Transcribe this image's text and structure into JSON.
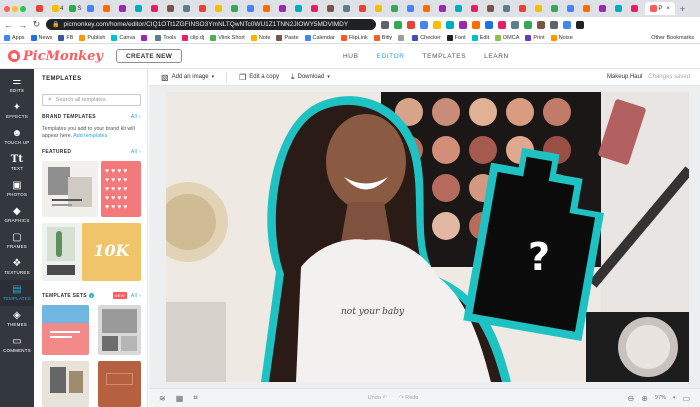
{
  "browser": {
    "tabs": [
      "",
      "4",
      "S",
      "",
      "",
      "",
      "",
      "",
      "",
      "",
      "",
      "",
      "",
      "",
      "",
      "",
      "",
      "",
      "",
      "",
      "",
      "",
      "",
      "",
      "",
      "",
      "",
      "",
      "",
      "",
      "",
      "",
      "",
      "",
      "",
      "",
      "",
      "",
      "P"
    ],
    "active_tab_label": "P",
    "new_tab": "+",
    "url": "picmonkey.com/home/editor/CIQ1OTt1ZGFINSO3YmNLTQwNTc0WU1Z1TNN2JIOWY5MDVIMDY",
    "bookmarks": [
      {
        "label": "Apps",
        "color": "#4285f4"
      },
      {
        "label": "News",
        "color": "#1a73e8"
      },
      {
        "label": "FB",
        "color": "#3b5998"
      },
      {
        "label": "Publish",
        "color": "#ff9800"
      },
      {
        "label": "Canva",
        "color": "#00c4cc"
      },
      {
        "label": "",
        "color": "#9c27b0"
      },
      {
        "label": "Tools",
        "color": "#607d8b"
      },
      {
        "label": "clip.dj",
        "color": "#e91e63"
      },
      {
        "label": "Vlink Short",
        "color": "#4caf50"
      },
      {
        "label": "Note",
        "color": "#f4b400"
      },
      {
        "label": "Paste",
        "color": "#795548"
      },
      {
        "label": "Calendar",
        "color": "#4285f4"
      },
      {
        "label": "FlipLink",
        "color": "#ff5722"
      },
      {
        "label": "Bitly",
        "color": "#ee6123"
      },
      {
        "label": "",
        "color": "#9e9e9e"
      },
      {
        "label": "Checker",
        "color": "#3f51b5"
      },
      {
        "label": "Font",
        "color": "#222222"
      },
      {
        "label": "Edit",
        "color": "#00bcd4"
      },
      {
        "label": "DMCA",
        "color": "#8bc34a"
      },
      {
        "label": "Print",
        "color": "#673ab7"
      },
      {
        "label": "Noise",
        "color": "#ff9800"
      }
    ],
    "other_bookmarks": "Other Bookmarks"
  },
  "app": {
    "logo": "PicMonkey",
    "create_new": "CREATE NEW",
    "nav": [
      "HUB",
      "EDITOR",
      "TEMPLATES",
      "LEARN"
    ],
    "nav_active": "EDITOR",
    "accent": "#27a9d8",
    "brand_color": "#ff5a5f"
  },
  "sidebar": {
    "items": [
      {
        "label": "EDITS",
        "icon": "sliders-icon"
      },
      {
        "label": "EFFECTS",
        "icon": "magic-wand-icon"
      },
      {
        "label": "TOUCH UP",
        "icon": "face-icon"
      },
      {
        "label": "TEXT",
        "icon": "text-icon"
      },
      {
        "label": "PHOTOS",
        "icon": "image-icon"
      },
      {
        "label": "GRAPHICS",
        "icon": "shapes-icon"
      },
      {
        "label": "FRAMES",
        "icon": "frame-icon"
      },
      {
        "label": "TEXTURES",
        "icon": "texture-icon"
      },
      {
        "label": "TEMPLATES",
        "icon": "templates-icon"
      },
      {
        "label": "THEMES",
        "icon": "themes-icon"
      },
      {
        "label": "COMMENTS",
        "icon": "comment-icon"
      }
    ],
    "active": "TEMPLATES"
  },
  "panel": {
    "title": "TEMPLATES",
    "search_placeholder": "Search all templates",
    "brand_heading": "BRAND TEMPLATES",
    "brand_all": "All",
    "brand_text": "Templates you add to your brand kit will appear here.",
    "brand_link": "Add templates.",
    "featured_heading": "FEATURED",
    "featured_all": "All",
    "sets_heading": "TEMPLATE SETS",
    "sets_new": "NEW",
    "sets_all": "All",
    "featured_thumb_text": "10K"
  },
  "toolbar": {
    "add_image": "Add an image",
    "edit_copy": "Edit a copy",
    "download": "Download",
    "project_name": "Makeup Haul",
    "save_status": "Changes saved"
  },
  "canvas": {
    "question_mark": "?",
    "shirt_text": "not your baby",
    "outline_color": "#1fc2c2"
  },
  "bottom": {
    "undo": "Undo",
    "redo": "Redo",
    "zoom": "97%"
  }
}
